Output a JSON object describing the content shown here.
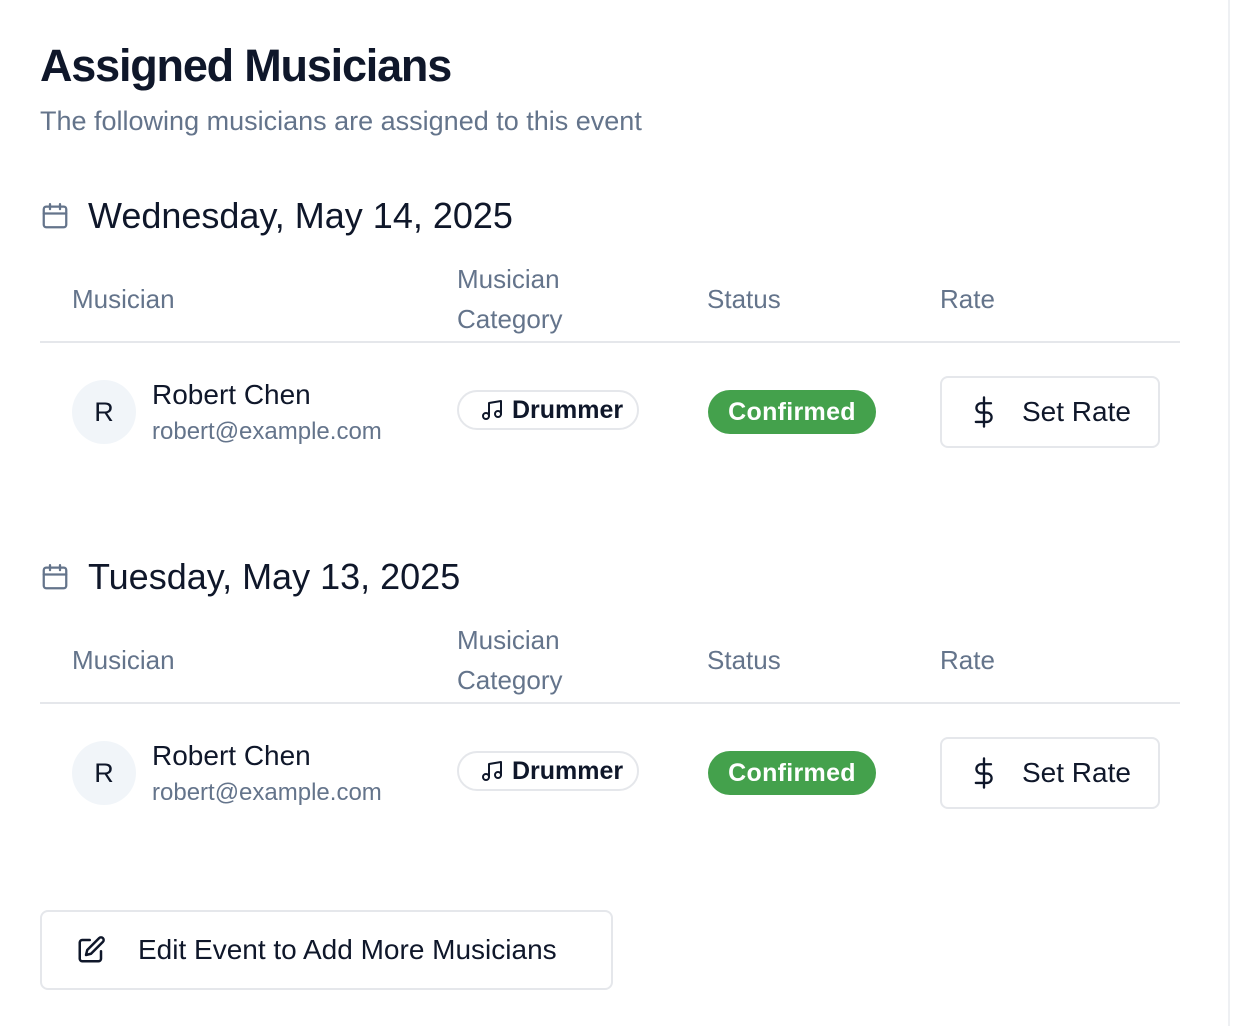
{
  "page": {
    "title": "Assigned Musicians",
    "subtitle": "The following musicians are assigned to this event"
  },
  "columns": {
    "musician": "Musician",
    "category": "Musician Category",
    "status": "Status",
    "rate": "Rate"
  },
  "dates": [
    {
      "label": "Wednesday, May 14, 2025",
      "musicians": [
        {
          "initial": "R",
          "name": "Robert Chen",
          "email": "robert@example.com",
          "category": "Drummer",
          "status": "Confirmed",
          "rate_button": "Set Rate"
        }
      ]
    },
    {
      "label": "Tuesday, May 13, 2025",
      "musicians": [
        {
          "initial": "R",
          "name": "Robert Chen",
          "email": "robert@example.com",
          "category": "Drummer",
          "status": "Confirmed",
          "rate_button": "Set Rate"
        }
      ]
    }
  ],
  "actions": {
    "edit_event": "Edit Event to Add More Musicians"
  },
  "icons": {
    "date": "calendar-icon",
    "category": "music-note-icon",
    "rate": "dollar-icon",
    "edit": "edit-icon"
  },
  "colors": {
    "status_confirmed": "#44a14c",
    "muted_text": "#64748b",
    "primary_text": "#0f172a",
    "border": "#e5e7eb"
  }
}
